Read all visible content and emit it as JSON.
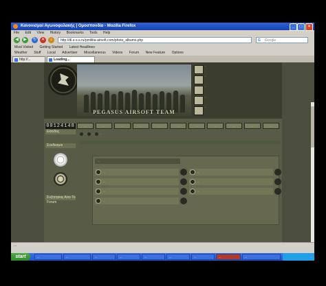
{
  "window": {
    "title": "Κανονισμοί Αγωνοφυλακής | Ομοσπονδία - Mozilla Firefox"
  },
  "menu": [
    "File",
    "Edit",
    "View",
    "History",
    "Bookmarks",
    "Tools",
    "Help"
  ],
  "address": {
    "url": "http://dl.s-s-s.ru/pmilitia-airsoft.com/photo_albums.php",
    "search_placeholder": "Google"
  },
  "bookmarks_row1": [
    "Most Visited",
    "Getting Started",
    "Latest Headlines"
  ],
  "bookmarks_row2": [
    "Weather",
    "Stuff",
    "Local",
    "Advertiser",
    "Miscellaneous",
    "Videos",
    "Forum",
    "New Feature",
    "Options"
  ],
  "tabs": [
    {
      "label": "http://...",
      "active": false
    },
    {
      "label": "Loading...",
      "active": true
    }
  ],
  "header": {
    "banner": "PEGASUS AIRSOFT TEAM"
  },
  "notes": [
    "...",
    "...",
    "...",
    "...",
    "..."
  ],
  "counter": "00124148",
  "nav_buttons": [
    "...",
    "...",
    "...",
    "...",
    "...",
    "...",
    "...",
    "...",
    "...",
    "...",
    "..."
  ],
  "sidebar": {
    "sections": [
      {
        "title": "Είσοδος",
        "text": "..."
      },
      {
        "title": "Συνδεσμοι",
        "text": ""
      },
      {
        "title": "Συζητησεις Απο Το Forum",
        "text": "..."
      }
    ]
  },
  "breadcrumbs": [
    "...",
    "...",
    "..."
  ],
  "panel": {
    "title": "...",
    "rows_left": [
      "...",
      "...",
      "...",
      "..."
    ],
    "rows_right": [
      "...",
      "...",
      "..."
    ]
  },
  "status_bar": "...",
  "taskbar": {
    "start": "start",
    "items": [
      "...",
      "...",
      "...",
      "...",
      "...",
      "...",
      "...",
      "...",
      "..."
    ],
    "clock": "..."
  }
}
